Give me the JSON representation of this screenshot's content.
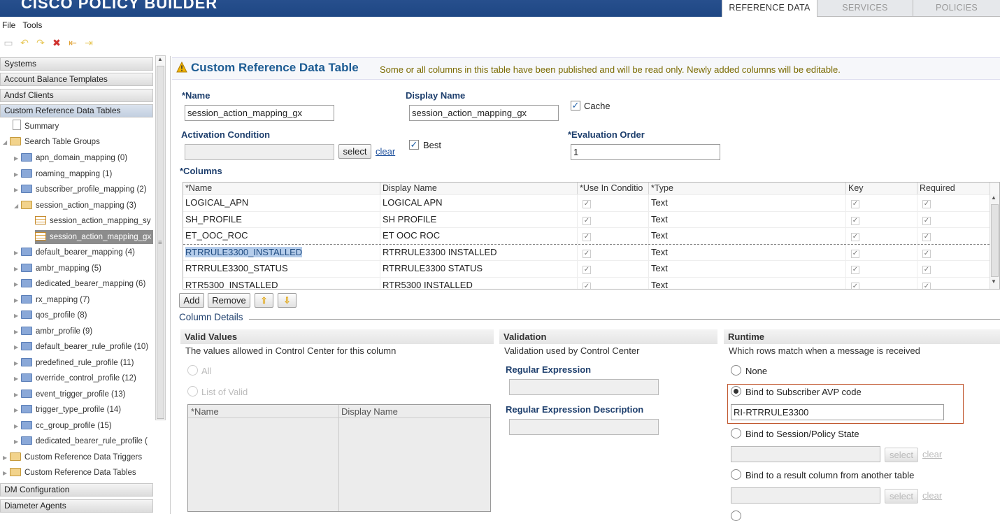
{
  "app": {
    "brand": "CISCO   POLICY BUILDER"
  },
  "top_tabs": [
    "REFERENCE DATA",
    "SERVICES",
    "POLICIES"
  ],
  "menu": [
    "File",
    "Tools"
  ],
  "nav": {
    "headers_top": [
      "Systems",
      "Account Balance Templates",
      "Andsf Clients",
      "Custom Reference Data Tables"
    ],
    "tree": {
      "summary": "Summary",
      "search_table_groups": "Search Table Groups",
      "groups": [
        "apn_domain_mapping (0)",
        "roaming_mapping (1)",
        "subscriber_profile_mapping (2)",
        "session_action_mapping (3)",
        "session_action_mapping_sy",
        "session_action_mapping_gx",
        "default_bearer_mapping (4)",
        "ambr_mapping (5)",
        "dedicated_bearer_mapping (6)",
        "rx_mapping (7)",
        "qos_profile (8)",
        "ambr_profile (9)",
        "default_bearer_rule_profile (10)",
        "predefined_rule_profile (11)",
        "override_control_profile (12)",
        "event_trigger_profile (13)",
        "trigger_type_profile (14)",
        "cc_group_profile (15)",
        "dedicated_bearer_rule_profile ("
      ],
      "triggers": "Custom Reference Data Triggers",
      "tables": "Custom Reference Data Tables"
    },
    "headers_bottom": [
      "DM Configuration",
      "Diameter Agents"
    ]
  },
  "page": {
    "title": "Custom Reference Data Table",
    "message": "Some or all columns in this table have been published and will be read only. Newly added columns will be editable."
  },
  "form": {
    "name_label": "*Name",
    "name_value": "session_action_mapping_gx",
    "display_label": "Display Name",
    "display_value": "session_action_mapping_gx",
    "cache_label": "Cache",
    "activation_label": "Activation Condition",
    "select_label": "select",
    "clear_label": "clear",
    "best_label": "Best",
    "eval_label": "*Evaluation Order",
    "eval_value": "1",
    "columns_label": "*Columns"
  },
  "grid": {
    "headers": [
      "*Name",
      "Display Name",
      "*Use In Conditio",
      "*Type",
      "Key",
      "Required"
    ],
    "rows": [
      {
        "name": "LOGICAL_APN",
        "display": "LOGICAL APN",
        "type": "Text"
      },
      {
        "name": "SH_PROFILE",
        "display": "SH PROFILE",
        "type": "Text"
      },
      {
        "name": "ET_OOC_ROC",
        "display": "ET OOC ROC",
        "type": "Text"
      },
      {
        "name": "RTRRULE3300_INSTALLED",
        "display": "RTRRULE3300 INSTALLED",
        "type": "Text"
      },
      {
        "name": "RTRRULE3300_STATUS",
        "display": "RTRRULE3300 STATUS",
        "type": "Text"
      },
      {
        "name": "RTR5300_INSTALLED",
        "display": "RTR5300 INSTALLED",
        "type": "Text"
      }
    ]
  },
  "grid_buttons": {
    "add": "Add",
    "remove": "Remove"
  },
  "column_details": "Column Details",
  "valid_values": {
    "title": "Valid Values",
    "desc": "The values allowed in Control Center for this column",
    "all": "All",
    "list": "List of Valid",
    "col_name": "*Name",
    "col_display": "Display Name"
  },
  "validation": {
    "title": "Validation",
    "desc": "Validation used by Control Center",
    "regex_label": "Regular Expression",
    "regex_desc_label": "Regular Expression Description"
  },
  "runtime": {
    "title": "Runtime",
    "desc": "Which rows match when a message is received",
    "none": "None",
    "bind_avp": "Bind to Subscriber AVP code",
    "avp_value": "RI-RTRRULE3300",
    "bind_session": "Bind to Session/Policy State",
    "bind_result": "Bind to a result column from another table",
    "select": "select",
    "clear": "clear"
  },
  "colors": {
    "banner": "#1e4784",
    "title": "#1d5c93",
    "highlight_box": "#c0562e"
  }
}
